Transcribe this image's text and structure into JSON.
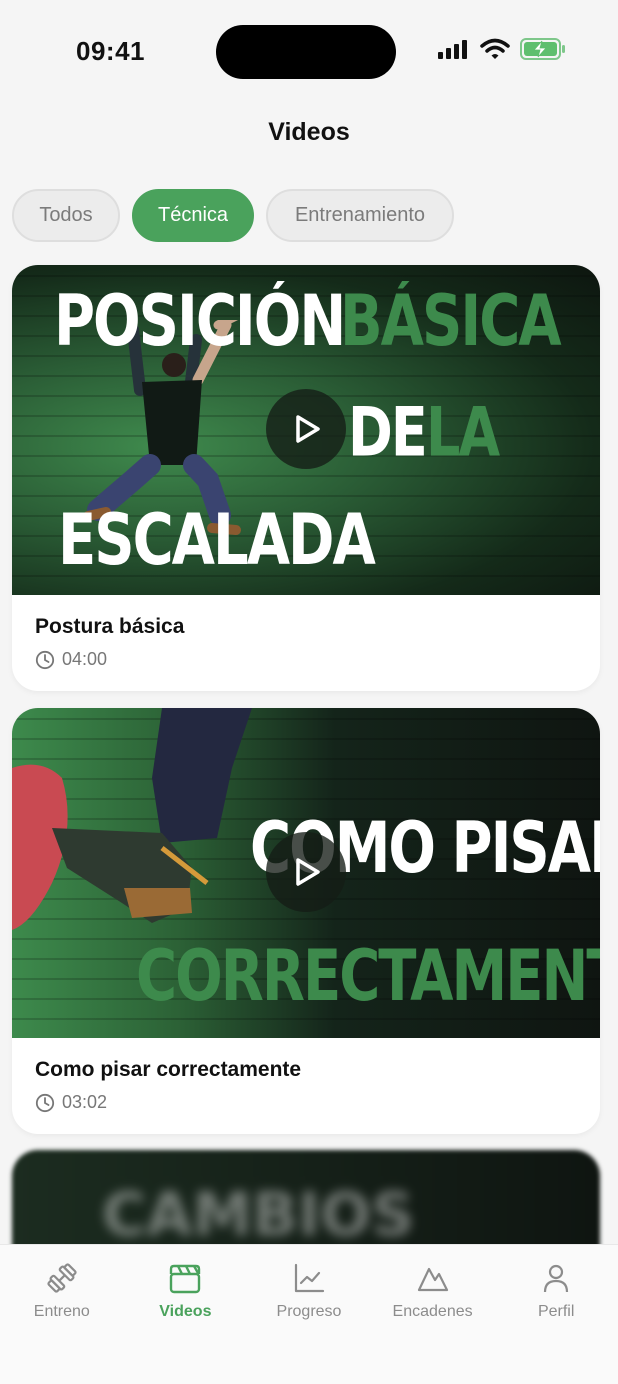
{
  "status": {
    "time": "09:41"
  },
  "header": {
    "title": "Videos"
  },
  "filters": [
    {
      "label": "Todos",
      "active": false
    },
    {
      "label": "Técnica",
      "active": true
    },
    {
      "label": "Entrenamiento",
      "active": false
    }
  ],
  "videos": [
    {
      "title": "Postura básica",
      "duration": "04:00",
      "thumb_words": [
        "POSICIÓN",
        "BÁSICA",
        "DE",
        "LA",
        "ESCALADA"
      ]
    },
    {
      "title": "Como pisar correctamente",
      "duration": "03:02",
      "thumb_words": [
        "COMO PISAR",
        "CORRECTAMENTE"
      ]
    }
  ],
  "partial_video": {
    "thumb_text": "CAMBIOS"
  },
  "nav": [
    {
      "label": "Entreno",
      "icon": "dumbbell-icon",
      "active": false
    },
    {
      "label": "Videos",
      "icon": "clapperboard-icon",
      "active": true
    },
    {
      "label": "Progreso",
      "icon": "chart-line-icon",
      "active": false
    },
    {
      "label": "Encadenes",
      "icon": "mountain-icon",
      "active": false
    },
    {
      "label": "Perfil",
      "icon": "user-icon",
      "active": false
    }
  ],
  "colors": {
    "accent": "#4aa25c",
    "thumb_green": "#3d8a4c"
  }
}
